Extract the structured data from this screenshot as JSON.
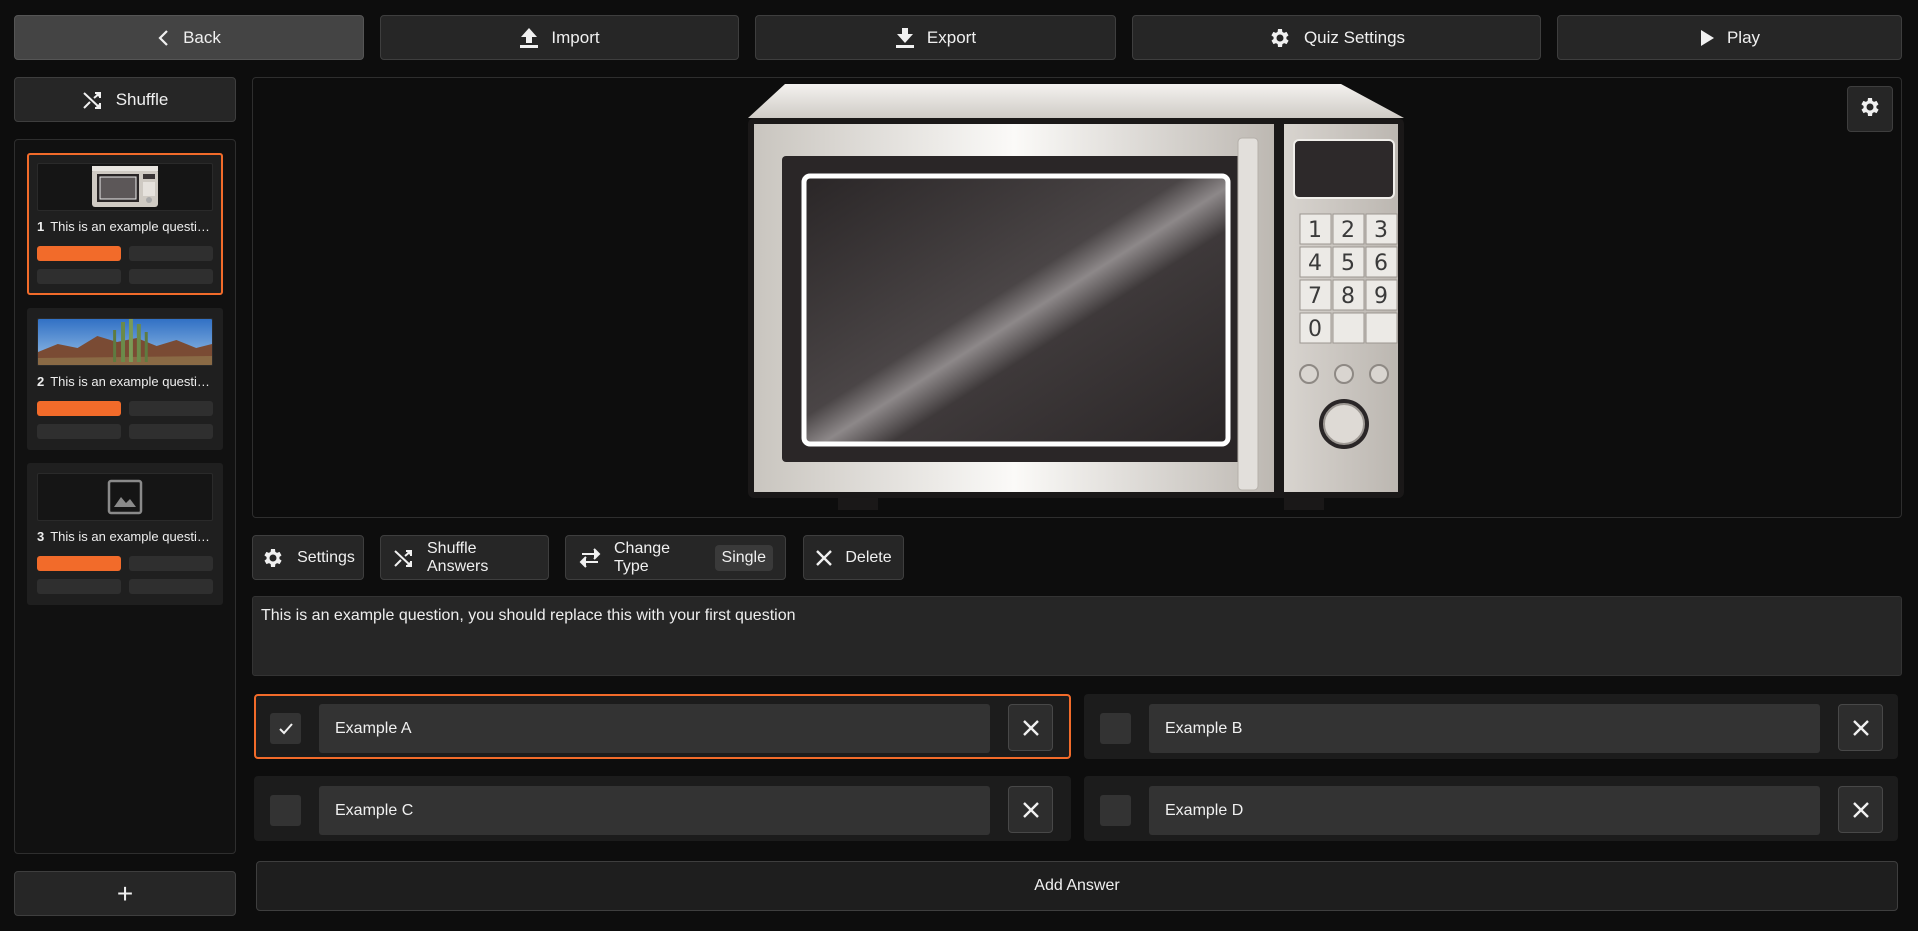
{
  "toolbar": {
    "back_label": "Back",
    "import_label": "Import",
    "export_label": "Export",
    "quiz_settings_label": "Quiz Settings",
    "play_label": "Play"
  },
  "sidebar": {
    "shuffle_label": "Shuffle",
    "add_label": "+",
    "questions": [
      {
        "number": "1",
        "title": "This is an example question, you should replace this with your first question",
        "thumbnail": "microwave-image"
      },
      {
        "number": "2",
        "title": "This is an example question, you should replace this with your first question",
        "thumbnail": "desert-cactus-image"
      },
      {
        "number": "3",
        "title": "This is an example question, you should replace this with your first question",
        "thumbnail": "image-placeholder-icon"
      }
    ]
  },
  "question_tools": {
    "settings_label": "Settings",
    "shuffle_answers_label": "Shuffle Answers",
    "change_type_label": "Change Type",
    "type_value": "Single",
    "delete_label": "Delete"
  },
  "editor": {
    "question_text": "This is an example question, you should replace this with your first question"
  },
  "answers": [
    {
      "label": "Example A",
      "correct": true
    },
    {
      "label": "Example B",
      "correct": false
    },
    {
      "label": "Example C",
      "correct": false
    },
    {
      "label": "Example D",
      "correct": false
    }
  ],
  "add_answer_label": "Add Answer",
  "colors": {
    "accent": "#f26b2a",
    "background": "#0d0d0d",
    "button": "#262626"
  }
}
